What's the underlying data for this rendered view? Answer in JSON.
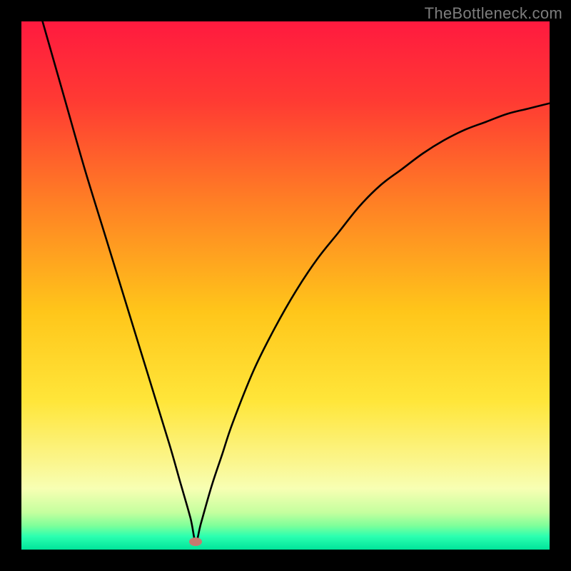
{
  "watermark": "TheBottleneck.com",
  "colors": {
    "frame": "#000000",
    "curve": "#000000",
    "marker": "#c77a6f",
    "gradient_stops": [
      {
        "offset": 0.0,
        "color": "#ff1a3f"
      },
      {
        "offset": 0.15,
        "color": "#ff3a33"
      },
      {
        "offset": 0.35,
        "color": "#ff8224"
      },
      {
        "offset": 0.55,
        "color": "#ffc61a"
      },
      {
        "offset": 0.72,
        "color": "#ffe63a"
      },
      {
        "offset": 0.83,
        "color": "#fbf58a"
      },
      {
        "offset": 0.885,
        "color": "#f7ffb3"
      },
      {
        "offset": 0.93,
        "color": "#c4ff9e"
      },
      {
        "offset": 0.955,
        "color": "#7dff9a"
      },
      {
        "offset": 0.975,
        "color": "#2bffb0"
      },
      {
        "offset": 1.0,
        "color": "#00e49a"
      }
    ]
  },
  "chart_data": {
    "type": "line",
    "title": "",
    "xlabel": "",
    "ylabel": "",
    "xlim": [
      0,
      100
    ],
    "ylim": [
      0,
      100
    ],
    "marker": {
      "x": 33,
      "y": 1.5
    },
    "series": [
      {
        "name": "bottleneck-curve",
        "x": [
          4,
          8,
          12,
          16,
          20,
          24,
          28,
          30,
          32,
          33,
          34,
          36,
          38,
          40,
          44,
          48,
          52,
          56,
          60,
          64,
          68,
          72,
          76,
          80,
          84,
          88,
          92,
          96,
          100
        ],
        "y": [
          100,
          86,
          72,
          59,
          46,
          33,
          20,
          13,
          6,
          1.5,
          5,
          12,
          18,
          24,
          34,
          42,
          49,
          55,
          60,
          65,
          69,
          72,
          75,
          77.5,
          79.5,
          81,
          82.5,
          83.5,
          84.5
        ]
      }
    ]
  }
}
